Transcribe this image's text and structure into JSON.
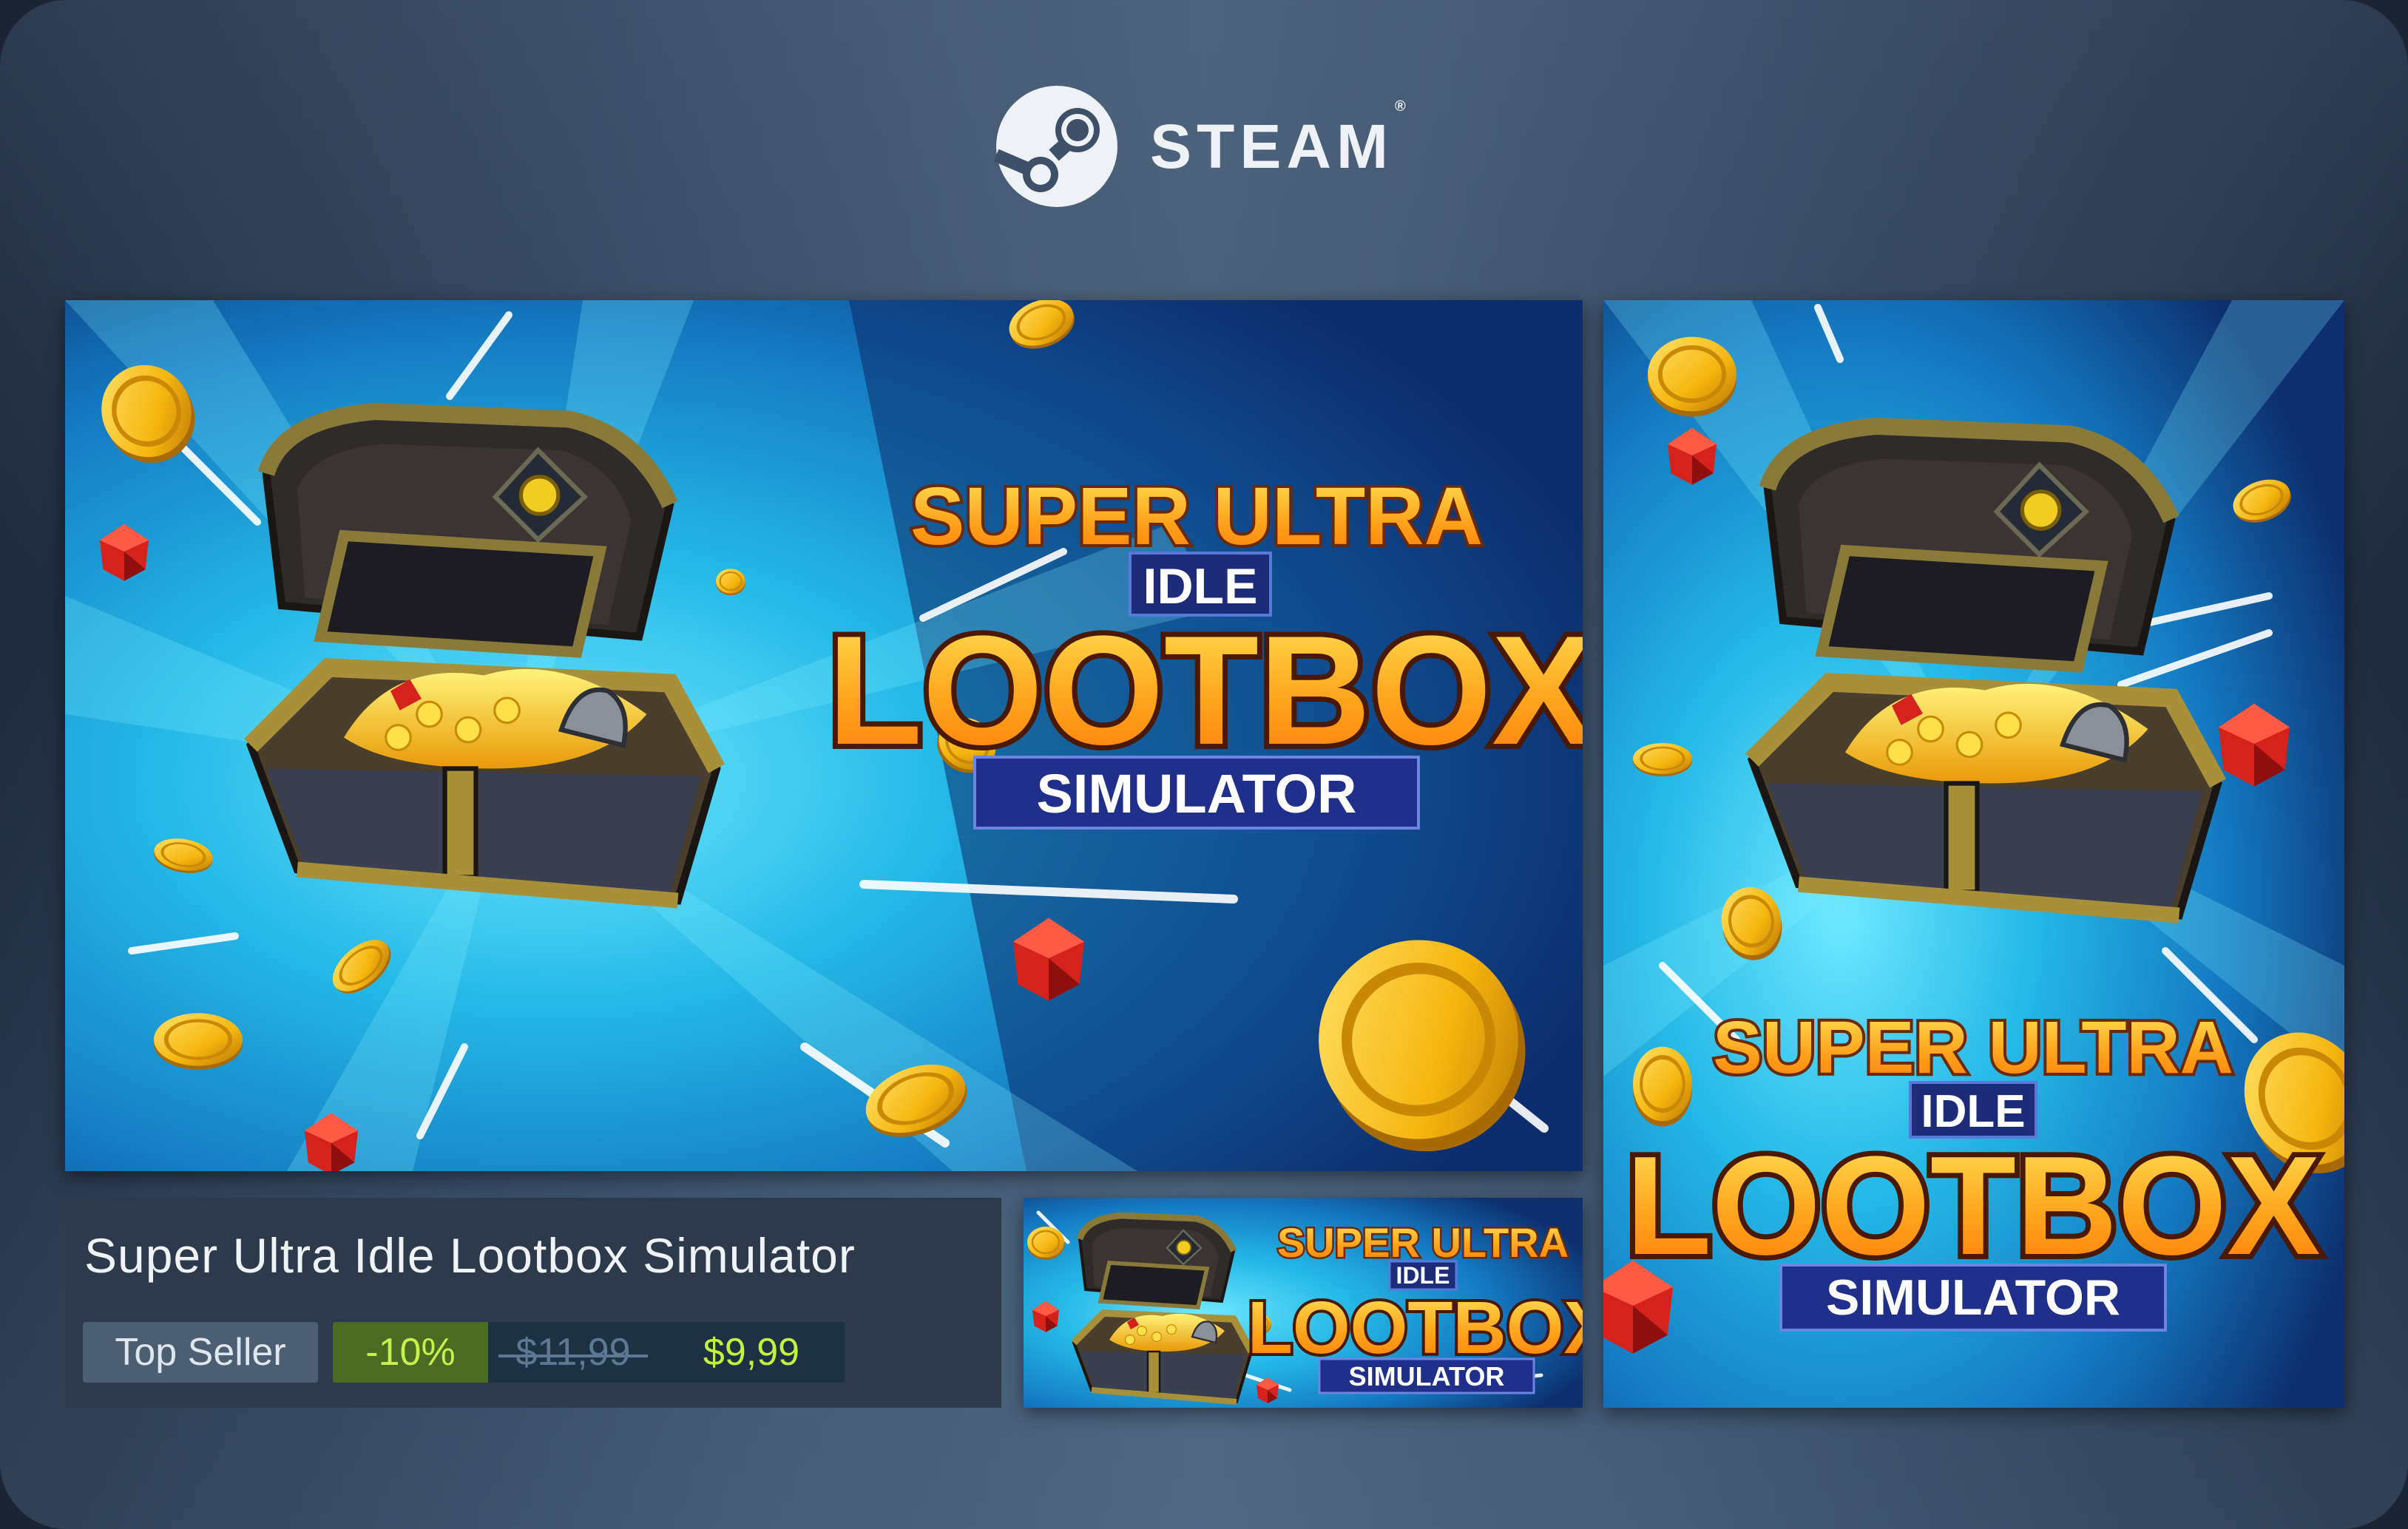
{
  "header": {
    "brand_name": "STEAM",
    "brand_mark": "®",
    "logo_icon": "steam-logo-icon"
  },
  "capsule_art": {
    "title_line1": "SUPER ULTRA",
    "title_line2": "IDLE",
    "title_line3": "LOOTBOX",
    "title_line4": "SIMULATOR"
  },
  "store_item": {
    "game_title": "Super Ultra Idle Lootbox Simulator",
    "tag": "Top Seller",
    "discount": "-10%",
    "original_price": "$11,99",
    "final_price": "$9,99"
  },
  "colors": {
    "price_green": "#bef33f",
    "discount_bg": "#4c6b22",
    "card_bg": "#2c3a4c"
  }
}
